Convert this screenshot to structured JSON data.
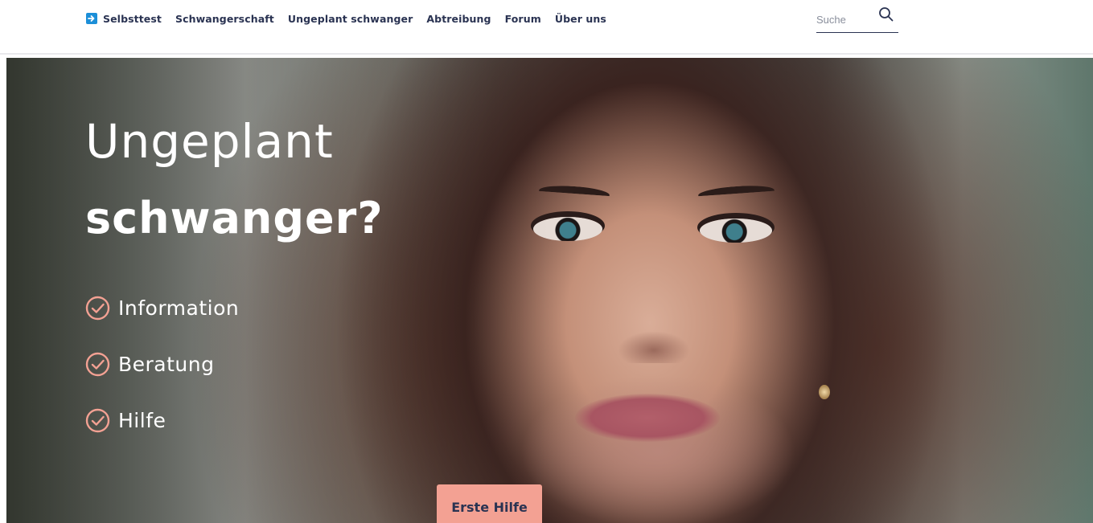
{
  "nav": {
    "items": [
      {
        "label": "Selbsttest"
      },
      {
        "label": "Schwangerschaft"
      },
      {
        "label": "Ungeplant schwanger"
      },
      {
        "label": "Abtreibung"
      },
      {
        "label": "Forum"
      },
      {
        "label": "Über uns"
      }
    ],
    "icon": "arrow-right-square-icon",
    "search_placeholder": "Suche",
    "search_icon": "search-icon"
  },
  "hero": {
    "title_line1": "Ungeplant",
    "title_line2": "schwanger?",
    "checklist": [
      {
        "label": "Information"
      },
      {
        "label": "Beratung"
      },
      {
        "label": "Hilfe"
      }
    ],
    "check_icon": "check-circle-icon",
    "cta_label": "Erste Hilfe"
  },
  "colors": {
    "nav_text": "#2a3352",
    "brand_blue": "#1c8fd8",
    "accent_salmon": "#f3a193",
    "hero_text": "#ffffff"
  }
}
